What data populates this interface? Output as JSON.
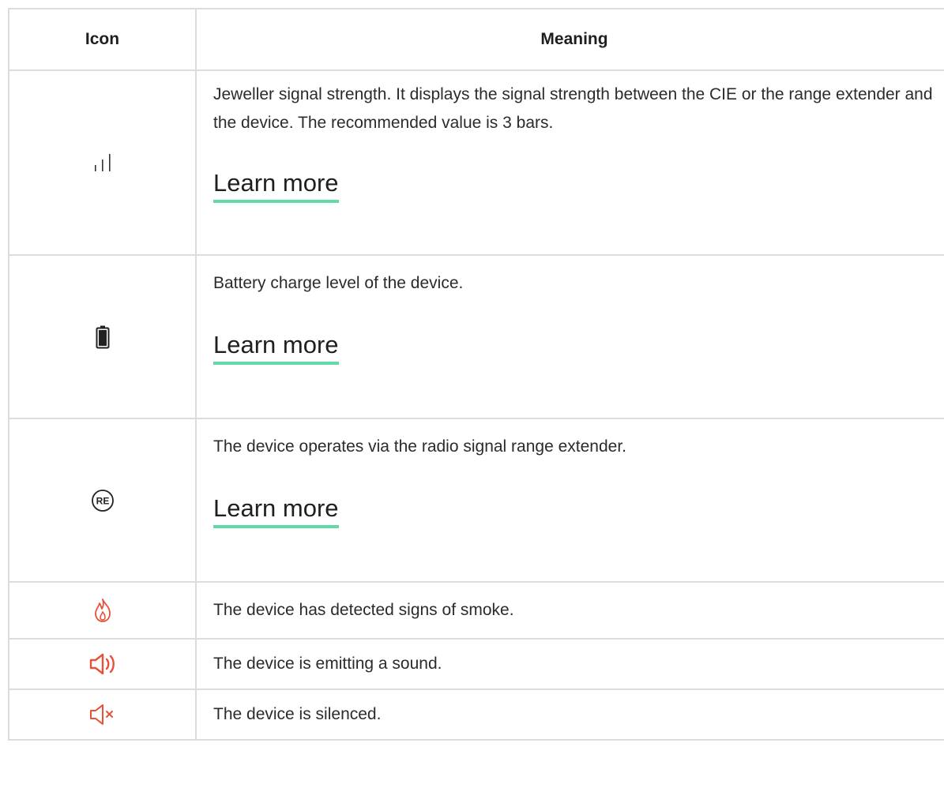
{
  "table": {
    "headers": {
      "icon": "Icon",
      "meaning": "Meaning"
    },
    "rows": [
      {
        "icon": "signal-strength-icon",
        "text": "Jeweller signal strength. It displays the signal strength between the CIE or the range extender and the device. The recommended value is 3 bars.",
        "link": "Learn more"
      },
      {
        "icon": "battery-icon",
        "text": "Battery charge level of the device.",
        "link": "Learn more"
      },
      {
        "icon": "range-extender-icon",
        "icon_text": "RE",
        "text": "The device operates via the radio signal range extender.",
        "link": "Learn more"
      },
      {
        "icon": "flame-icon",
        "text": "The device has detected signs of smoke."
      },
      {
        "icon": "speaker-sound-icon",
        "text": "The device is emitting a sound."
      },
      {
        "icon": "speaker-muted-icon",
        "text": "The device is silenced."
      }
    ]
  },
  "colors": {
    "alert": "#e8503a",
    "link_underline": "#5fdba3",
    "border": "#dcdcdc"
  }
}
